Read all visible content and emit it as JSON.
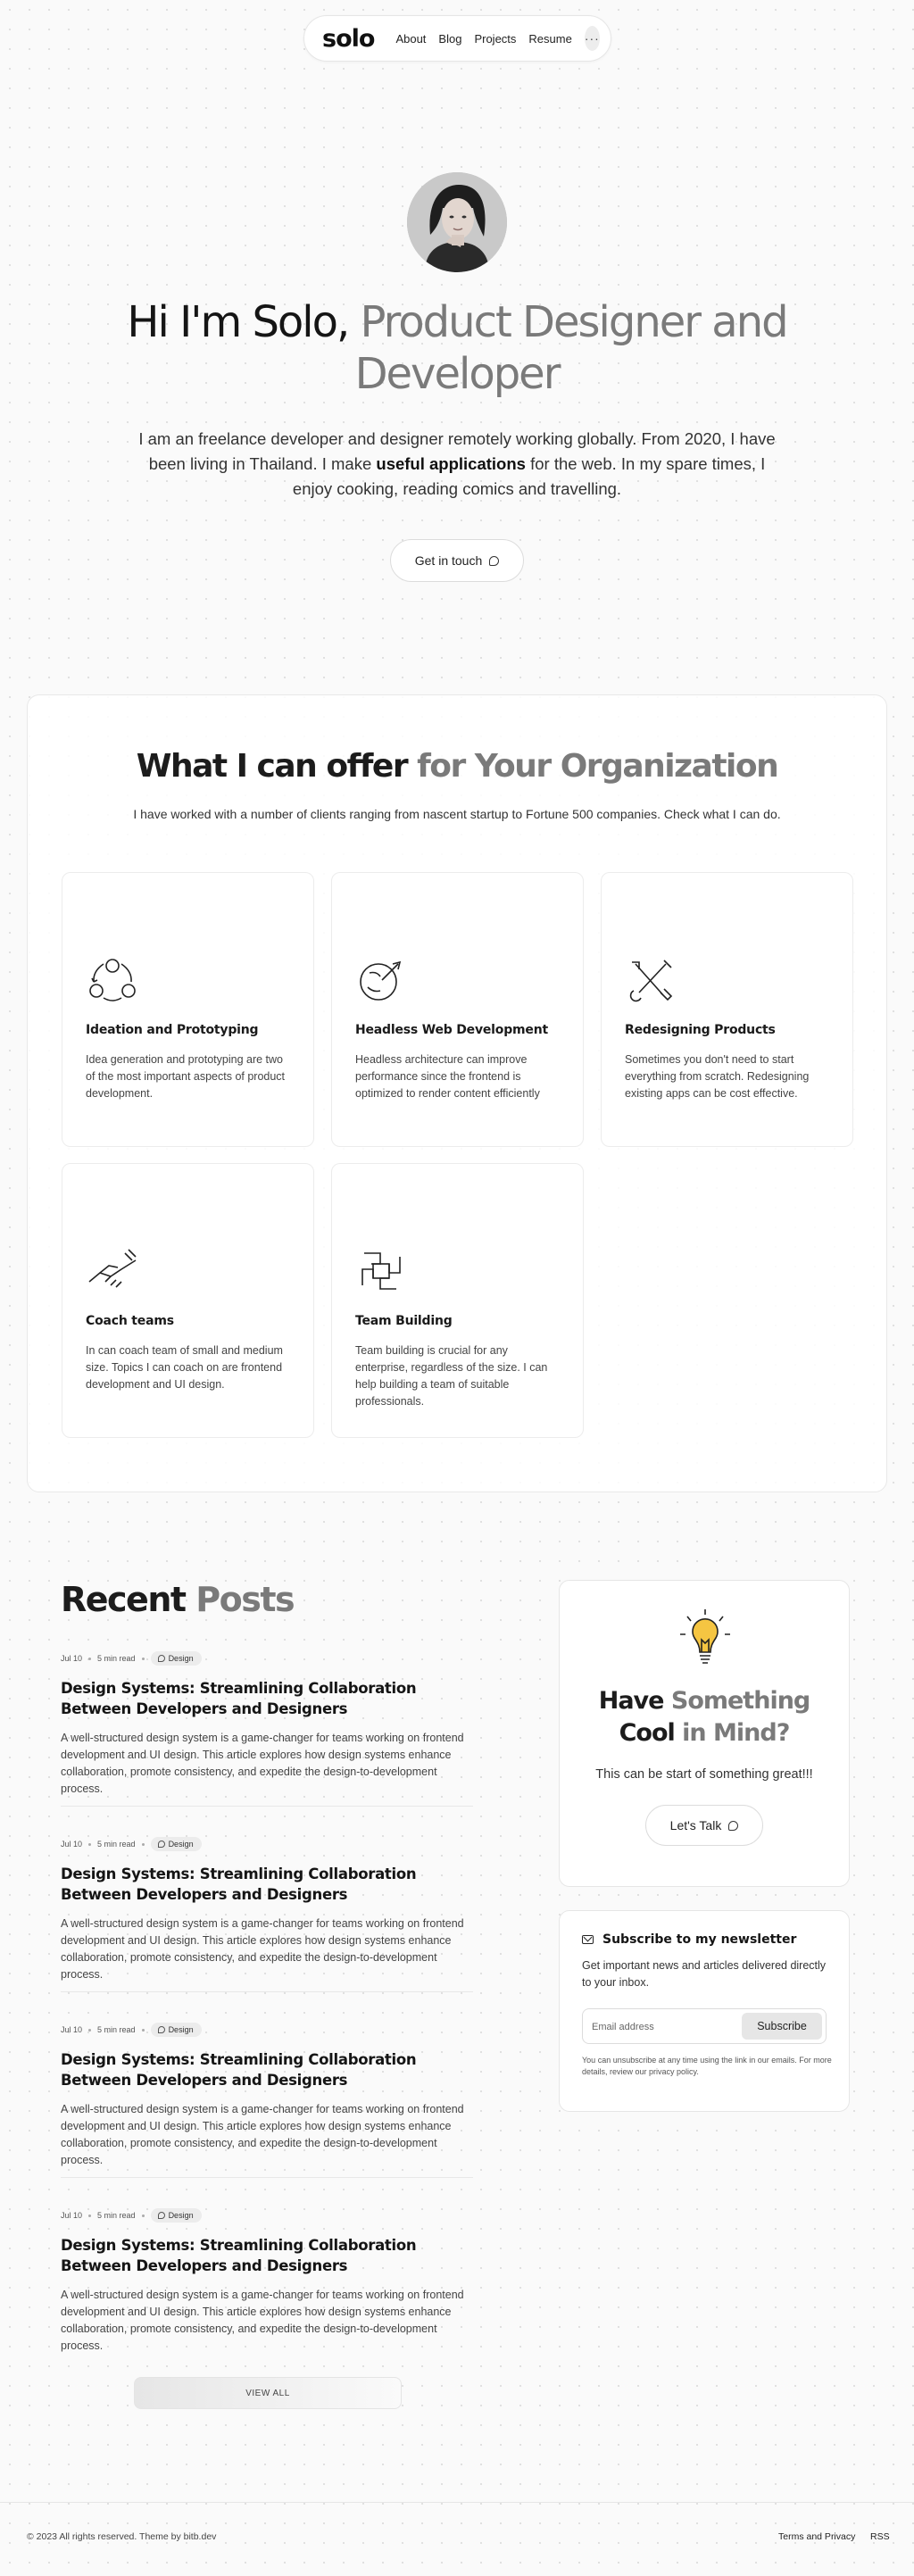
{
  "nav": {
    "logo": "solo",
    "links": [
      "About",
      "Blog",
      "Projects",
      "Resume"
    ],
    "more_label": "···"
  },
  "hero": {
    "title_dark": "Hi I'm Solo,",
    "title_grey_1": " Product Designer and",
    "title_grey_2": "Developer",
    "desc_before": "I am an freelance developer and designer remotely working globally. From 2020, I have been living in Thailand. I make ",
    "desc_bold": "useful applications",
    "desc_after": " for the web. In my spare times, I enjoy cooking, reading comics and travelling.",
    "cta": "Get in touch"
  },
  "services": {
    "title_dark": "What I can offer",
    "title_grey": " for Your Organization",
    "subtitle": "I have worked with a number of  clients ranging from nascent startup to Fortune 500 companies. Check what I can do.",
    "cards": [
      {
        "icon": "ideation-cycle-icon",
        "title": "Ideation and Prototyping",
        "desc": "Idea generation and prototyping are two of the most important aspects of product development."
      },
      {
        "icon": "rocket-globe-icon",
        "title": "Headless Web Development",
        "desc": "Headless architecture can improve performance since the frontend is optimized to render content efficiently"
      },
      {
        "icon": "tools-icon",
        "title": "Redesigning Products",
        "desc": "Sometimes you don't need to start everything from scratch. Redesigning existing apps can be cost effective."
      },
      {
        "icon": "handshake-icon",
        "title": "Coach teams",
        "desc": "In can coach team of small and medium size. Topics I can coach on are frontend development and UI design."
      },
      {
        "icon": "team-hands-icon",
        "title": "Team Building",
        "desc": "Team building is crucial for any enterprise, regardless of the size. I can help building a team of suitable professionals."
      }
    ]
  },
  "posts": {
    "title_dark": "Recent",
    "title_grey": " Posts",
    "items": [
      {
        "date": "Jul 10",
        "read": "5 min read",
        "tag": "Design",
        "title": "Design Systems: Streamlining Collaboration Between Developers and Designers",
        "excerpt": "A well-structured design system is a game-changer for teams working on frontend development and UI design. This article explores how design systems enhance collaboration, promote consistency, and expedite the design-to-development process."
      },
      {
        "date": "Jul 10",
        "read": "5 min read",
        "tag": "Design",
        "title": "Design Systems: Streamlining Collaboration Between Developers and Designers",
        "excerpt": "A well-structured design system is a game-changer for teams working on frontend development and UI design. This article explores how design systems enhance collaboration, promote consistency, and expedite the design-to-development process."
      },
      {
        "date": "Jul 10",
        "read": "5 min read",
        "tag": "Design",
        "title": "Design Systems: Streamlining Collaboration Between Developers and Designers",
        "excerpt": "A well-structured design system is a game-changer for teams working on frontend development and UI design. This article explores how design systems enhance collaboration, promote consistency, and expedite the design-to-development process."
      },
      {
        "date": "Jul 10",
        "read": "5 min read",
        "tag": "Design",
        "title": "Design Systems: Streamlining Collaboration Between Developers and Designers",
        "excerpt": "A well-structured design system is a game-changer for teams working on frontend development and UI design. This article explores how design systems enhance collaboration, promote consistency, and expedite the design-to-development process."
      }
    ],
    "view_all": "VIEW ALL"
  },
  "cool": {
    "icon": "lightbulb-icon",
    "title_dark_1": "Have",
    "title_grey_1": " Something",
    "title_dark_2": "Cool",
    "title_grey_2": " in Mind?",
    "subtitle": "This can be start of something great!!!",
    "button": "Let's Talk"
  },
  "newsletter": {
    "title": "Subscribe to my newsletter",
    "desc": "Get important news and articles delivered directly to your inbox.",
    "placeholder": "Email address",
    "button": "Subscribe",
    "note": "You can unsubscribe at any time using the link in our emails. For more details, review our privacy policy."
  },
  "footer": {
    "copyright": "© 2023 All rights reserved. Theme by bitb.dev",
    "links": [
      "Terms and Privacy",
      "RSS"
    ]
  },
  "colors": {
    "text": "#1c1c1c",
    "muted": "#7a7a7a",
    "bulb": "#f5c542"
  }
}
